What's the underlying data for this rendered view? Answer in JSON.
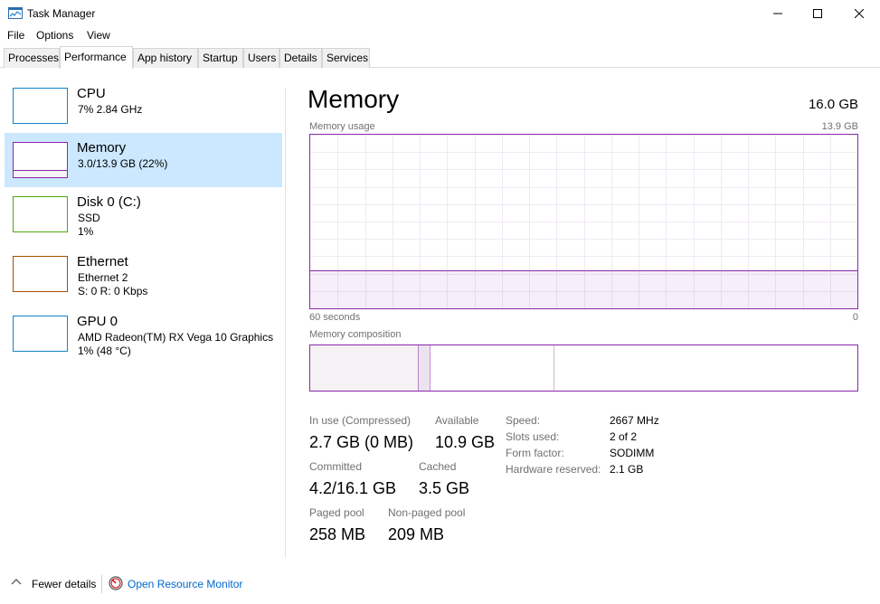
{
  "window": {
    "title": "Task Manager"
  },
  "menu": [
    "File",
    "Options",
    "View"
  ],
  "tabs": [
    "Processes",
    "Performance",
    "App history",
    "Startup",
    "Users",
    "Details",
    "Services"
  ],
  "sidebar": [
    {
      "title": "CPU",
      "line1": "7%  2.84 GHz",
      "line2": "",
      "color": "#1185c6"
    },
    {
      "title": "Memory",
      "line1": "3.0/13.9 GB (22%)",
      "line2": "",
      "color": "#8b28a8"
    },
    {
      "title": "Disk 0 (C:)",
      "line1": "SSD",
      "line2": "1%",
      "color": "#4da80b"
    },
    {
      "title": "Ethernet",
      "line1": "Ethernet 2",
      "line2": "S: 0 R: 0 Kbps",
      "color": "#a74f01"
    },
    {
      "title": "GPU 0",
      "line1": "AMD Radeon(TM) RX Vega 10 Graphics",
      "line2": "1%  (48 °C)",
      "color": "#1185c6"
    }
  ],
  "main": {
    "title": "Memory",
    "total": "16.0 GB",
    "usage_label": "Memory usage",
    "usage_max": "13.9 GB",
    "time_left": "60 seconds",
    "time_right": "0",
    "usage_fraction": 0.22,
    "composition_label": "Memory composition",
    "composition": {
      "in_use_fraction": 0.196,
      "modified_fraction": 0.021,
      "standby_fraction": 0.227
    },
    "accent": "#8b28a8"
  },
  "stats": {
    "in_use_label": "In use (Compressed)",
    "in_use_value": "2.7 GB (0 MB)",
    "available_label": "Available",
    "available_value": "10.9 GB",
    "committed_label": "Committed",
    "committed_value": "4.2/16.1 GB",
    "cached_label": "Cached",
    "cached_value": "3.5 GB",
    "paged_label": "Paged pool",
    "paged_value": "258 MB",
    "nonpaged_label": "Non-paged pool",
    "nonpaged_value": "209 MB"
  },
  "details": [
    {
      "label": "Speed:",
      "value": "2667 MHz"
    },
    {
      "label": "Slots used:",
      "value": "2 of 2"
    },
    {
      "label": "Form factor:",
      "value": "SODIMM"
    },
    {
      "label": "Hardware reserved:",
      "value": "2.1 GB"
    }
  ],
  "footer": {
    "fewer_details": "Fewer details",
    "resource_monitor": "Open Resource Monitor"
  }
}
